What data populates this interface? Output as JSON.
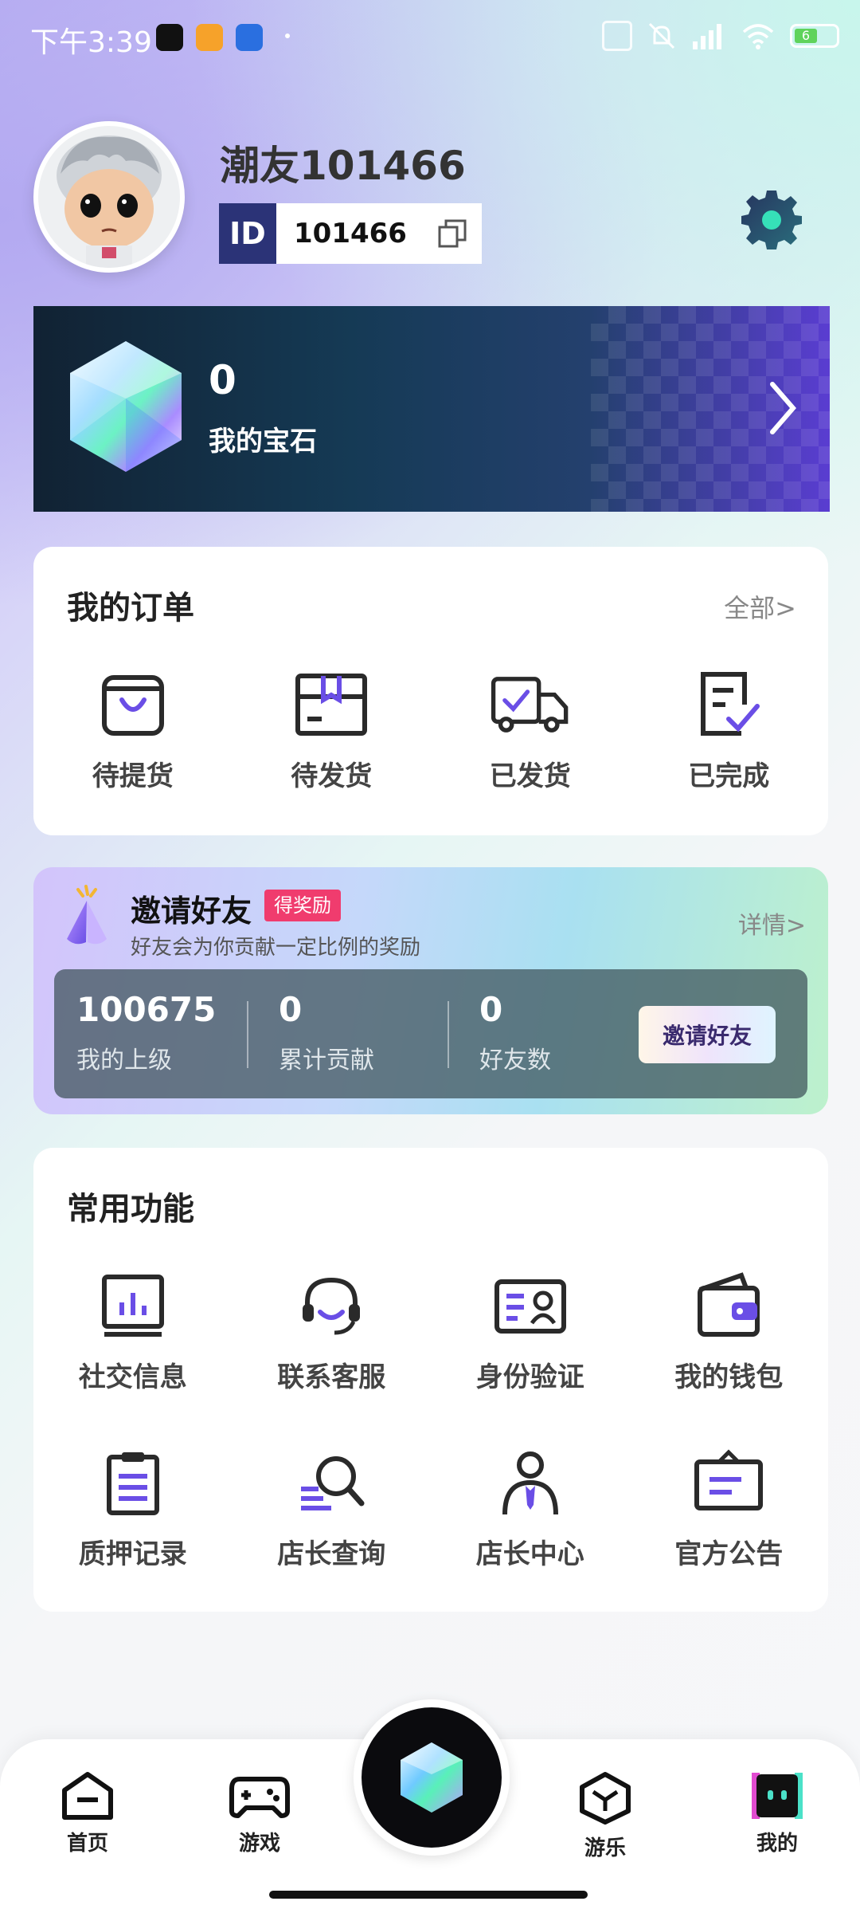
{
  "status_bar": {
    "time": "下午3:39",
    "battery": "6"
  },
  "profile": {
    "username": "潮友101466",
    "id_badge": "ID",
    "id_value": "101466"
  },
  "gems": {
    "count": "0",
    "label": "我的宝石"
  },
  "orders": {
    "title": "我的订单",
    "all_link": "全部>",
    "items": [
      {
        "label": "待提货",
        "icon": "shopping-bag-icon"
      },
      {
        "label": "待发货",
        "icon": "package-box-icon"
      },
      {
        "label": "已发货",
        "icon": "delivery-truck-icon"
      },
      {
        "label": "已完成",
        "icon": "completed-document-icon"
      }
    ]
  },
  "invite": {
    "title": "邀请好友",
    "badge": "得奖励",
    "subtitle": "好友会为你贡献一定比例的奖励",
    "detail_link": "详情>",
    "stats": [
      {
        "value": "100675",
        "label": "我的上级"
      },
      {
        "value": "0",
        "label": "累计贡献"
      },
      {
        "value": "0",
        "label": "好友数"
      }
    ],
    "button": "邀请好友"
  },
  "functions": {
    "title": "常用功能",
    "items": [
      {
        "label": "社交信息",
        "icon": "chart-board-icon"
      },
      {
        "label": "联系客服",
        "icon": "headset-icon"
      },
      {
        "label": "身份验证",
        "icon": "id-card-icon"
      },
      {
        "label": "我的钱包",
        "icon": "wallet-icon"
      },
      {
        "label": "质押记录",
        "icon": "clipboard-icon"
      },
      {
        "label": "店长查询",
        "icon": "search-list-icon"
      },
      {
        "label": "店长中心",
        "icon": "manager-person-icon"
      },
      {
        "label": "官方公告",
        "icon": "announcement-icon"
      }
    ]
  },
  "bottom_nav": {
    "items": [
      {
        "label": "首页",
        "icon": "home-icon"
      },
      {
        "label": "游戏",
        "icon": "gamepad-icon"
      },
      {
        "label": "游乐",
        "icon": "cube-icon"
      },
      {
        "label": "我的",
        "icon": "profile-robot-icon"
      }
    ],
    "center_icon": "gem-icon"
  },
  "colors": {
    "accent": "#6a4ee6",
    "id_badge": "#2b3377",
    "invite_badge": "#f03c6e"
  }
}
